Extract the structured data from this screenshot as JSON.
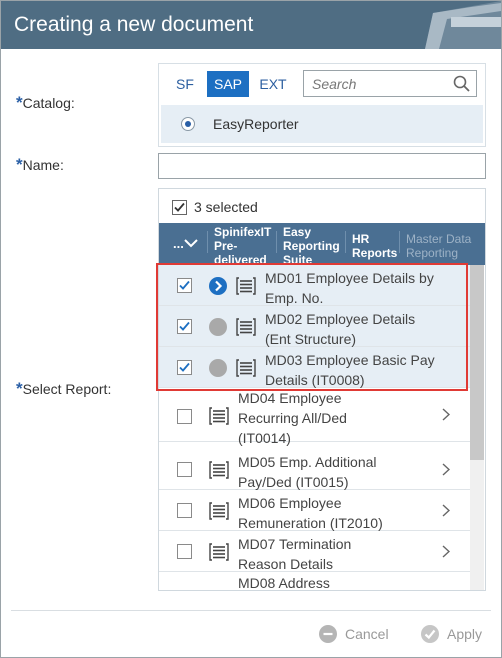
{
  "dialog": {
    "title": "Creating a new document"
  },
  "labels": {
    "required": "*",
    "catalog": "Catalog:",
    "name": "Name:",
    "select_report": "Select Report:"
  },
  "catalog": {
    "tabs": [
      "SF",
      "SAP",
      "EXT"
    ],
    "active_tab": "SAP",
    "search": {
      "placeholder": "Search",
      "value": ""
    },
    "selected": "EasyReporter"
  },
  "name_field": {
    "value": ""
  },
  "reports": {
    "selected_count": "3 selected",
    "groups_more": "...",
    "groups": [
      {
        "label": "SpinifexIT Pre-delivered",
        "lines": [
          "SpinifexIT",
          "Pre-",
          "delivered"
        ]
      },
      {
        "label": "Easy Reporting Suite",
        "lines": [
          "Easy",
          "Reporting",
          "Suite"
        ]
      },
      {
        "label": "HR Reports",
        "lines": [
          "HR",
          "Reports"
        ]
      },
      {
        "label": "Master Data Reporting",
        "lines": [
          "Master Data",
          "Reporting"
        ]
      }
    ],
    "items": [
      {
        "lines": [
          "MD01 Employee Details by",
          "Emp. No."
        ],
        "checked": true,
        "status": "arrow"
      },
      {
        "lines": [
          "MD02 Employee Details",
          "(Ent Structure)"
        ],
        "checked": true,
        "status": "grey"
      },
      {
        "lines": [
          "MD03 Employee Basic Pay",
          "Details (IT0008)"
        ],
        "checked": true,
        "status": "grey"
      },
      {
        "lines": [
          "MD04 Employee",
          "Recurring All/Ded",
          "(IT0014)"
        ],
        "checked": false
      },
      {
        "lines": [
          "MD05 Emp. Additional",
          "Pay/Ded (IT0015)"
        ],
        "checked": false
      },
      {
        "lines": [
          "MD06 Employee",
          "Remuneration (IT2010)"
        ],
        "checked": false
      },
      {
        "lines": [
          "MD07 Termination",
          "Reason Details"
        ],
        "checked": false
      },
      {
        "lines": [
          "MD08 Address"
        ],
        "checked": false
      }
    ]
  },
  "buttons": {
    "cancel": "Cancel",
    "apply": "Apply"
  },
  "colors": {
    "title_bar": "#4f6d83",
    "accent_blue": "#1d6fc2",
    "group_bar": "#4a6f92",
    "highlight": "#e03a35"
  }
}
